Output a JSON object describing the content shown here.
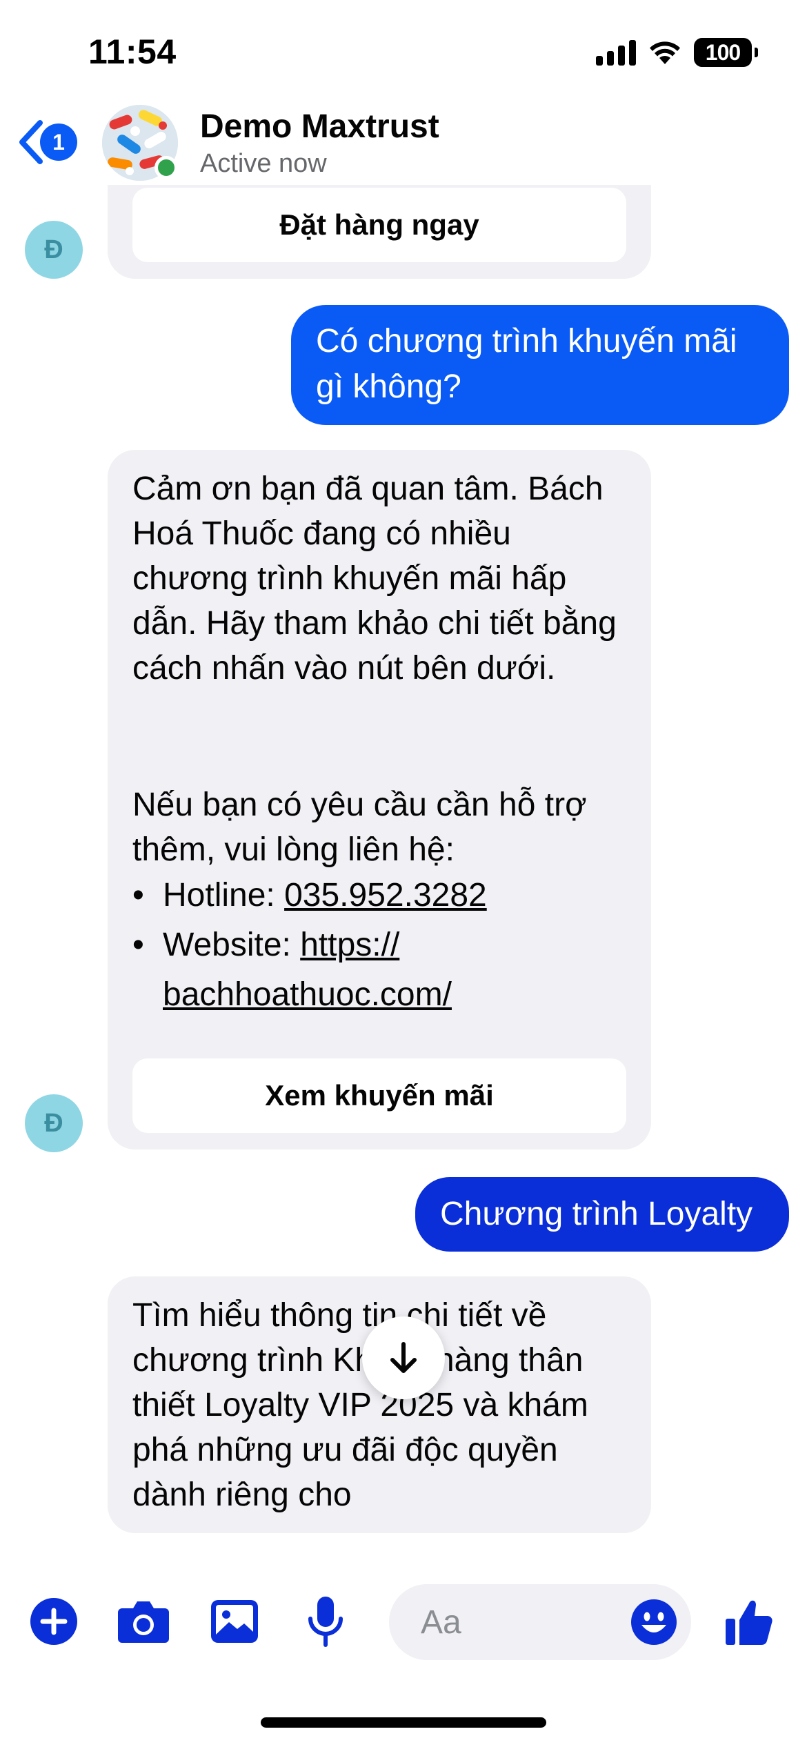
{
  "status_bar": {
    "time": "11:54",
    "battery": "100"
  },
  "header": {
    "back_badge": "1",
    "contact_name": "Demo Maxtrust",
    "contact_status": "Active now"
  },
  "sender_initial": "Đ",
  "messages": {
    "card1_button": "Đặt hàng ngay",
    "user_msg1": "Có chương trình khuyến mãi gì không?",
    "bot_msg2_para1": "Cảm ơn bạn đã quan tâm. Bách Hoá Thuốc đang có nhiều chương trình khuyến mãi hấp dẫn. Hãy tham khảo chi tiết bằng cách nhấn vào nút bên dưới.",
    "bot_msg2_para2": "Nếu bạn có yêu cầu cần hỗ trợ thêm, vui lòng liên hệ:",
    "hotline_label": "Hotline: ",
    "hotline_value": "035.952.3282",
    "website_label": "Website: ",
    "website_value_line1": "https://",
    "website_value_line2": "bachhoathuoc.com/",
    "card2_button": "Xem khuyến mãi",
    "user_msg2": "Chương trình Loyalty",
    "bot_msg3": "Tìm hiểu thông tin chi tiết về chương trình Khách hàng thân thiết Loyalty VIP 2025 và khám phá những ưu đãi độc quyền dành riêng cho"
  },
  "composer": {
    "placeholder": "Aa"
  },
  "colors": {
    "accent": "#0a5bf5",
    "user_bubble_1": "#0a5bf5",
    "user_bubble_2": "#0a2ed8",
    "toolbar_icon": "#0a2ed8",
    "incoming_bubble": "#f0f0f5",
    "online": "#31a24c"
  },
  "icons": {
    "back": "chevron-left-icon",
    "add": "plus-circle-icon",
    "camera": "camera-icon",
    "gallery": "photo-icon",
    "mic": "microphone-icon",
    "emoji": "smiley-icon",
    "like": "thumbs-up-icon",
    "scroll": "arrow-down-icon"
  }
}
